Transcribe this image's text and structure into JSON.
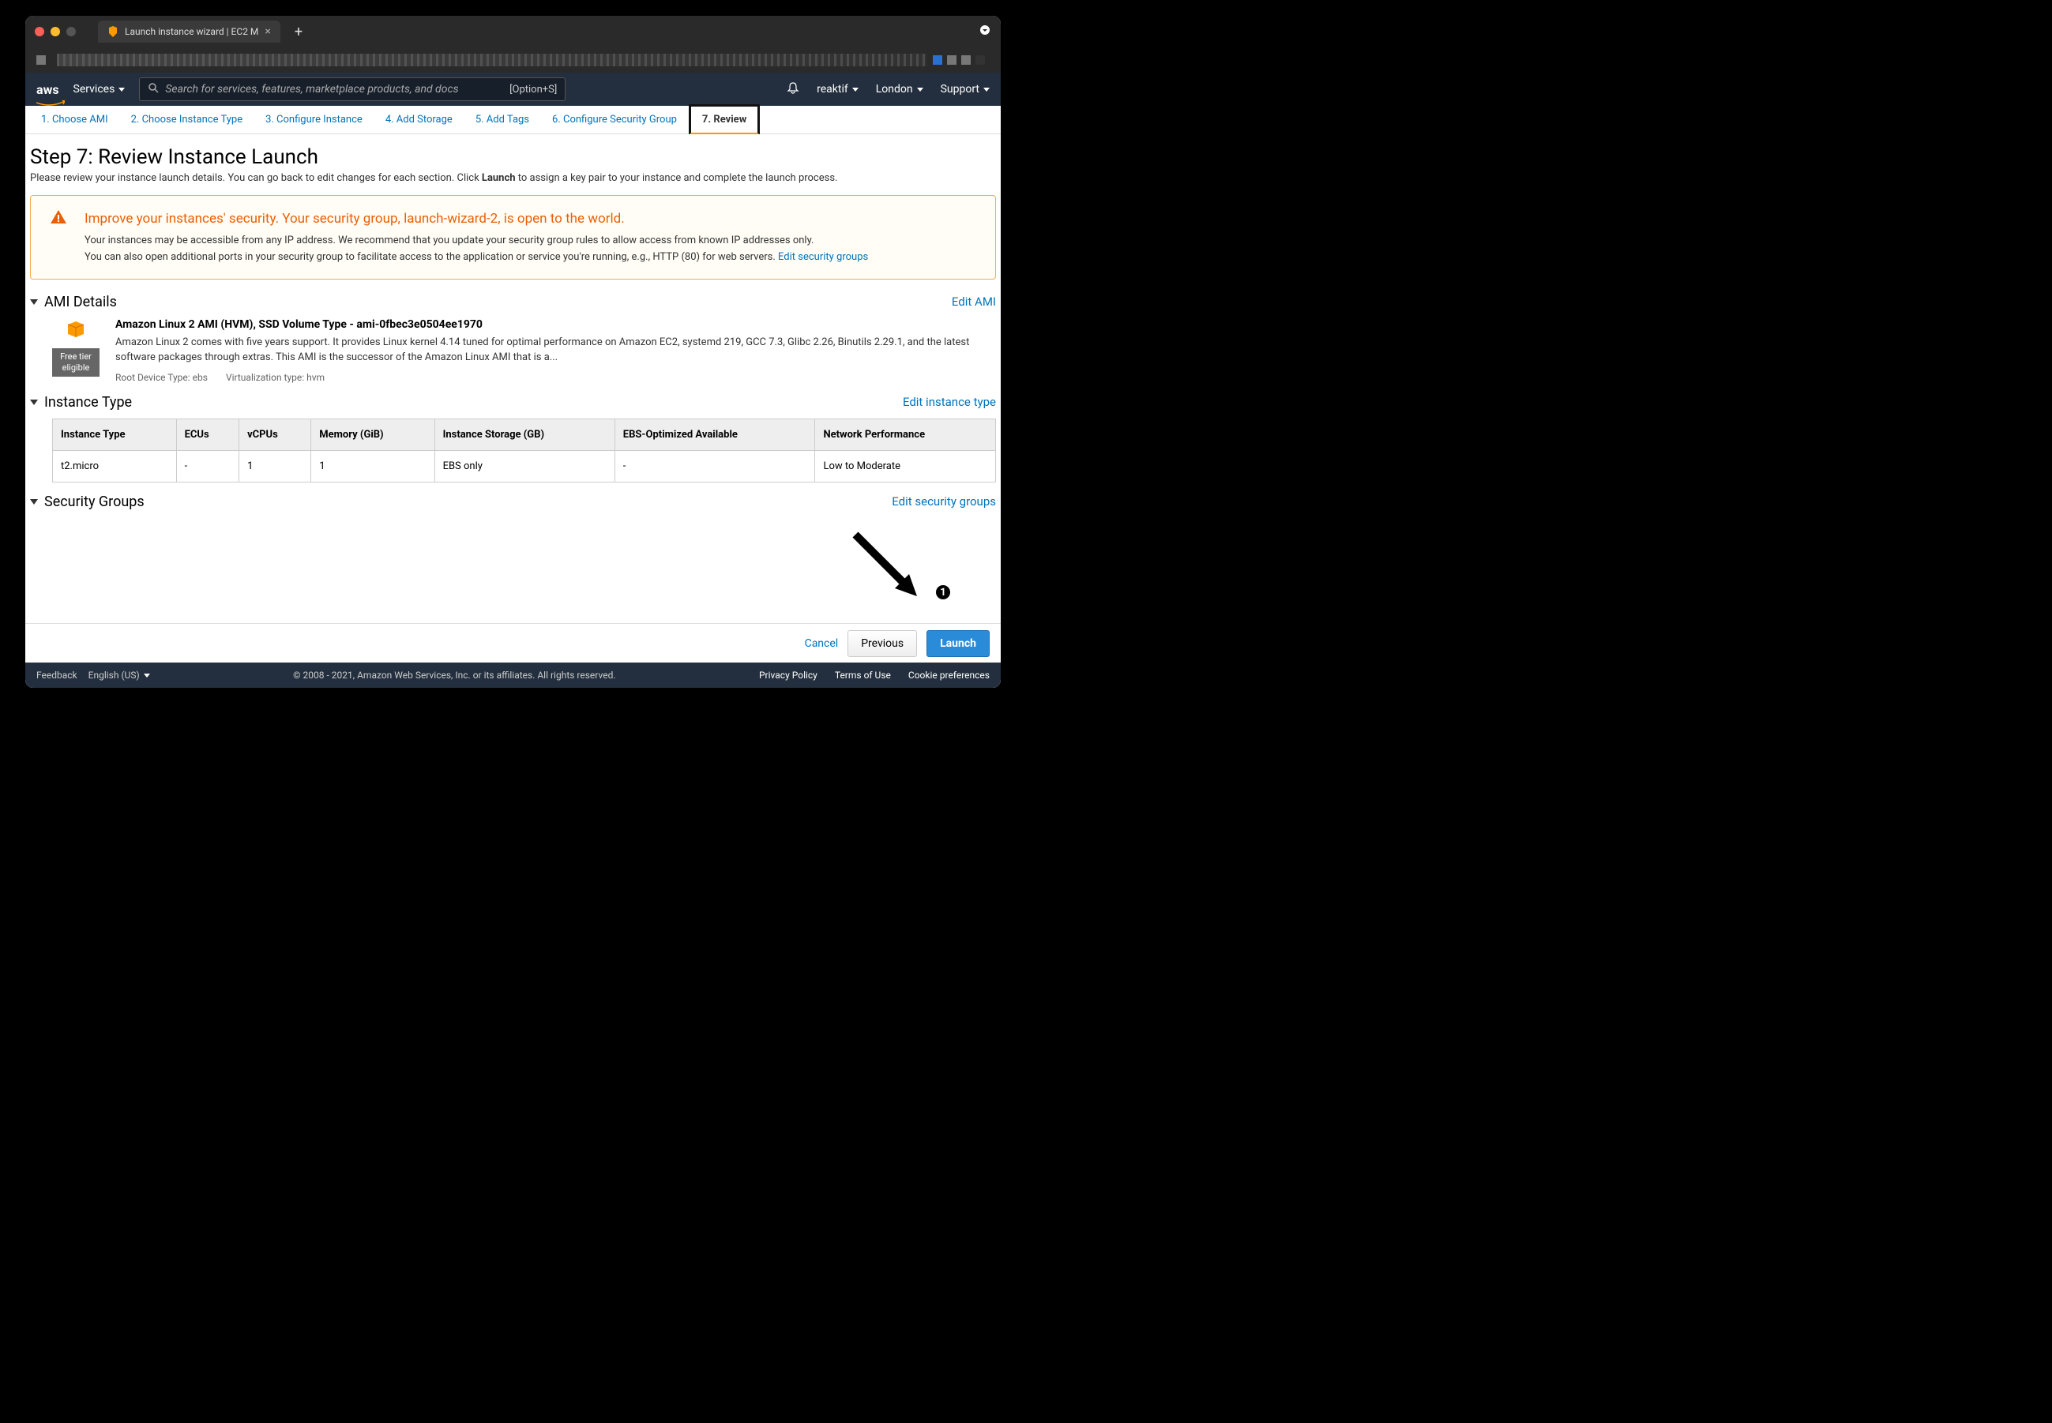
{
  "browser": {
    "tab_title": "Launch instance wizard | EC2 M"
  },
  "aws_header": {
    "services": "Services",
    "search_placeholder": "Search for services, features, marketplace products, and docs",
    "search_shortcut": "[Option+S]",
    "account": "reaktif",
    "region": "London",
    "support": "Support"
  },
  "wizard_tabs": [
    "1. Choose AMI",
    "2. Choose Instance Type",
    "3. Configure Instance",
    "4. Add Storage",
    "5. Add Tags",
    "6. Configure Security Group",
    "7. Review"
  ],
  "page": {
    "title": "Step 7: Review Instance Launch",
    "subtitle_pre": "Please review your instance launch details. You can go back to edit changes for each section. Click ",
    "subtitle_bold": "Launch",
    "subtitle_post": " to assign a key pair to your instance and complete the launch process."
  },
  "alert": {
    "title": "Improve your instances' security. Your security group, launch-wizard-2, is open to the world.",
    "line1": "Your instances may be accessible from any IP address. We recommend that you update your security group rules to allow access from known IP addresses only.",
    "line2_pre": "You can also open additional ports in your security group to facilitate access to the application or service you're running, e.g., HTTP (80) for web servers. ",
    "edit_link": "Edit security groups"
  },
  "ami": {
    "section_title": "AMI Details",
    "edit_link": "Edit AMI",
    "free_tier": "Free tier eligible",
    "title": "Amazon Linux 2 AMI (HVM), SSD Volume Type - ami-0fbec3e0504ee1970",
    "description": "Amazon Linux 2 comes with five years support. It provides Linux kernel 4.14 tuned for optimal performance on Amazon EC2, systemd 219, GCC 7.3, Glibc 2.26, Binutils 2.29.1, and the latest software packages through extras. This AMI is the successor of the Amazon Linux AMI that is a...",
    "root_device": "Root Device Type: ebs",
    "virt_type": "Virtualization type: hvm"
  },
  "instance_type": {
    "section_title": "Instance Type",
    "edit_link": "Edit instance type",
    "headers": [
      "Instance Type",
      "ECUs",
      "vCPUs",
      "Memory (GiB)",
      "Instance Storage (GB)",
      "EBS-Optimized Available",
      "Network Performance"
    ],
    "row": [
      "t2.micro",
      "-",
      "1",
      "1",
      "EBS only",
      "-",
      "Low to Moderate"
    ]
  },
  "security_groups": {
    "section_title": "Security Groups",
    "edit_link": "Edit security groups"
  },
  "footer_buttons": {
    "cancel": "Cancel",
    "previous": "Previous",
    "launch": "Launch"
  },
  "aws_footer": {
    "feedback": "Feedback",
    "language": "English (US)",
    "copyright": "© 2008 - 2021, Amazon Web Services, Inc. or its affiliates. All rights reserved.",
    "links": [
      "Privacy Policy",
      "Terms of Use",
      "Cookie preferences"
    ]
  },
  "callout": {
    "badge": "1"
  }
}
